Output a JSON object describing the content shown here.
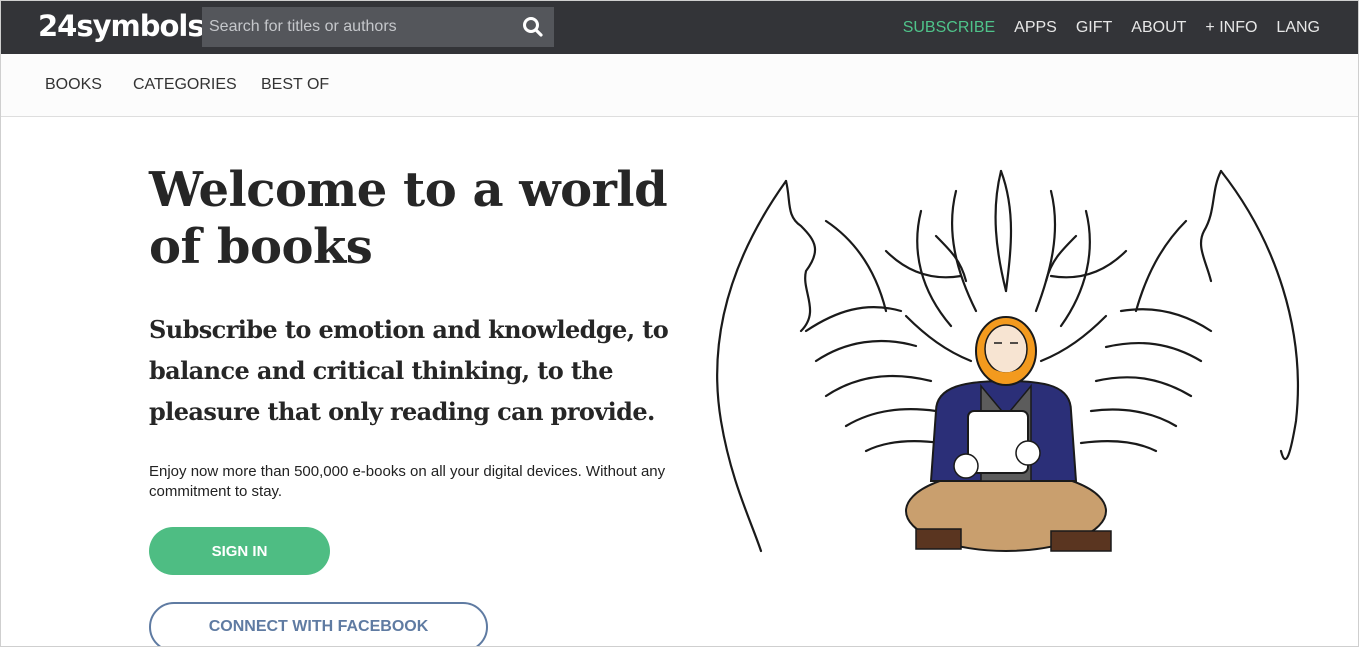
{
  "header": {
    "logo_text": "24symbols",
    "search_placeholder": "Search for titles or authors",
    "nav": {
      "subscribe": "SUBSCRIBE",
      "apps": "APPS",
      "gift": "GIFT",
      "about": "ABOUT",
      "info": "+ INFO",
      "lang": "LANG"
    }
  },
  "subnav": {
    "books": "BOOKS",
    "categories": "CATEGORIES",
    "best_of": "BEST OF"
  },
  "hero": {
    "title": "Welcome to a world of books",
    "subtitle": "Subscribe to emotion and knowledge, to balance and critical thinking, to the pleasure that only reading can provide.",
    "body": "Enjoy now more than 500,000 e-books on all your digital devices. Without any commitment to stay.",
    "signin_label": "SIGN IN",
    "facebook_label": "CONNECT WITH FACEBOOK"
  },
  "colors": {
    "topbar": "#333438",
    "accent_green": "#4ebd83",
    "facebook_blue": "#5f7ba2"
  },
  "icons": {
    "search": "search-icon",
    "illustration": "reader-with-dragon-illustration"
  }
}
